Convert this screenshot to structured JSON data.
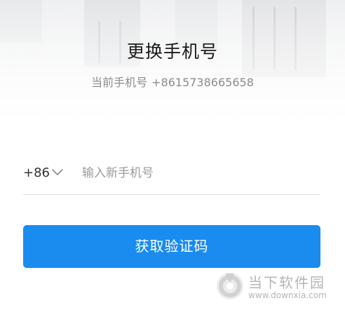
{
  "header": {
    "title": "更换手机号",
    "current_label": "当前手机号",
    "current_number": "+8615738665658"
  },
  "form": {
    "country_code": "+86",
    "phone_placeholder": "输入新手机号",
    "phone_value": "",
    "submit_label": "获取验证码"
  },
  "watermark": {
    "name": "当下软件园",
    "url": "www.downxia.com"
  },
  "colors": {
    "accent": "#1a8cf0",
    "title": "#1a1a1a",
    "muted": "#8c8c8c"
  },
  "icons": {
    "country_dropdown": "chevron-down-icon",
    "watermark_logo": "downxia-logo-icon"
  }
}
